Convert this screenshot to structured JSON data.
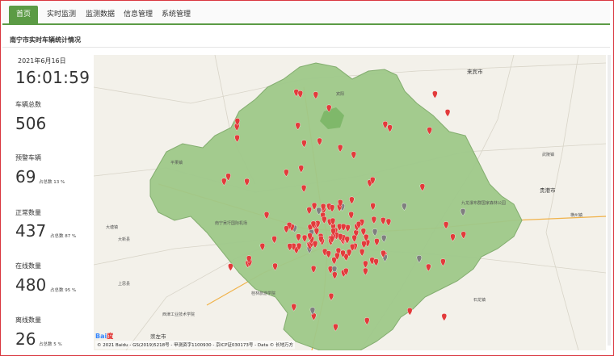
{
  "nav": {
    "tabs": [
      {
        "label": "首页",
        "active": true
      },
      {
        "label": "实时监测",
        "active": false
      },
      {
        "label": "监测数据",
        "active": false
      },
      {
        "label": "信息管理",
        "active": false
      },
      {
        "label": "系统管理",
        "active": false
      }
    ],
    "accent": "#5b9b45"
  },
  "panel": {
    "title": "南宁市实时车辆统计情况"
  },
  "stats": {
    "date": "2021年6月16日",
    "time": "16:01:59",
    "total_label": "车辆总数",
    "total_value": "506",
    "alarm_label": "预警车辆",
    "alarm_value": "69",
    "alarm_pct": "占总数 13 %",
    "normal_label": "正常数量",
    "normal_value": "437",
    "normal_pct": "占总数 87 %",
    "online_label": "在线数量",
    "online_value": "480",
    "online_pct": "占总数 95 %",
    "offline_label": "离线数量",
    "offline_value": "26",
    "offline_pct": "占总数 5 %"
  },
  "map": {
    "copyright": "© 2021 Baidu - GS(2019)5218号 - 甲测资字1100930 - 京ICP证030173号 - Data © 长地万方",
    "logo_text": "Bai",
    "logo_accent": "度",
    "region_color": "#9fc98a",
    "marker_red": "#e23b3b",
    "marker_grey": "#7f7f7f",
    "labels": [
      {
        "text": "来宾市",
        "kind": "city"
      },
      {
        "text": "贵港市",
        "kind": "city"
      },
      {
        "text": "崇左市",
        "kind": "city"
      },
      {
        "text": "宾阳",
        "kind": "town"
      },
      {
        "text": "武陵镇",
        "kind": "town"
      },
      {
        "text": "九龙瀑布群国家森林公园",
        "kind": "town"
      },
      {
        "text": "大塘镇",
        "kind": "town"
      },
      {
        "text": "大新县",
        "kind": "town"
      },
      {
        "text": "南宁吴圩国际机场",
        "kind": "town"
      },
      {
        "text": "横州镇",
        "kind": "town"
      },
      {
        "text": "西津工业技术学院",
        "kind": "town"
      },
      {
        "text": "桂林旅游学院",
        "kind": "town"
      },
      {
        "text": "石龙镇",
        "kind": "town"
      },
      {
        "text": "上思县",
        "kind": "town"
      },
      {
        "text": "平果镇",
        "kind": "town"
      }
    ]
  }
}
